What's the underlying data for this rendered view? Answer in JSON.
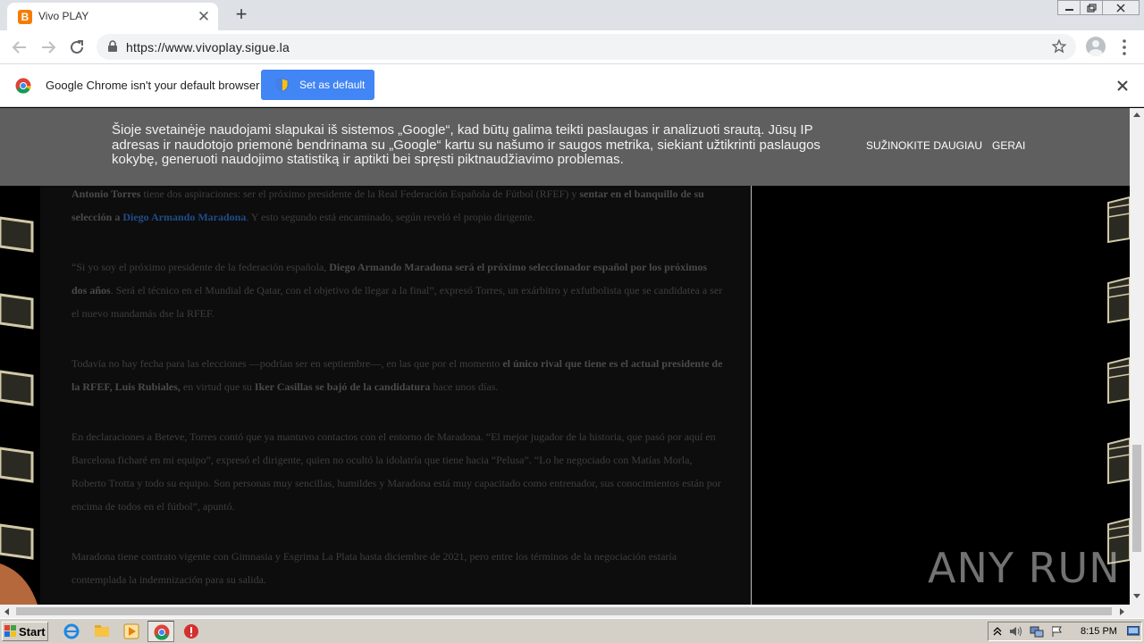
{
  "browser": {
    "tab_title": "Vivo PLAY",
    "url": "https://www.vivoplay.sigue.la"
  },
  "infobar": {
    "message": "Google Chrome isn't your default browser",
    "button_label": "Set as default"
  },
  "cookie_banner": {
    "text": "Šioje svetainėje naudojami slapukai iš sistemos „Google“, kad būtų galima teikti paslaugas ir analizuoti srautą. Jūsų IP adresas ir naudotojo priemonė bendrinama su „Google“ kartu su našumo ir saugos metrika, siekiant užtikrinti paslaugos kokybę, generuoti naudojimo statistiką ir aptikti bei spręsti piktnaudžiavimo problemas.",
    "learn_more": "SUŽINOKITE DAUGIAU",
    "accept": "GERAI"
  },
  "article": {
    "p1": {
      "b1": "Antonio Torres",
      "t1": " tiene dos aspiraciones: ser el próximo presidente de la Real Federación Española de Fútbol (RFEF) y ",
      "b2": "sentar en el banquillo de su selección a ",
      "link": "Diego Armando Maradona",
      "t2": ". Y esto segundo está encaminado, según reveló el propio dirigente."
    },
    "p2": {
      "t1": "“Si yo soy el próximo presidente de la federación española, ",
      "b1": "Diego Armando Maradona será el próximo seleccionador español por los próximos dos años",
      "t2": ". Será el técnico en el Mundial de Qatar, con el objetivo de llegar a la final”, expresó Torres, un exárbitro y exfutbolista que se candidatea a ser el nuevo mandamás dse la RFEF."
    },
    "p3": {
      "t1": "Todavía no hay fecha para las elecciones —podrían ser en septiembre—, en las que por el momento ",
      "b1": "el único rival que tiene es el actual presidente de la RFEF, Luis Rubiales,",
      "t2": " en virtud que su ",
      "b2": "Iker Casillas se bajó de la candidatura",
      "t3": " hace unos días."
    },
    "p4": "En declaraciones a Beteve, Torres contó que ya mantuvo contactos con el entorno de Maradona. “El mejor jugador de la historia, que pasó por aquí en Barcelona ficharé en mi equipo”, expresó el dirigente, quien no ocultó la idolatría que tiene hacia “Pelusa”. “Lo he negociado con Matías Morla, Roberto Trotta y todo su equipo. Son personas muy sencillas, humildes y Maradona está muy capacitado como entrenador, sus conocimientos están por encima de todos en el fútbol”, apuntó.",
    "p5": "Maradona tiene contrato vigente con Gimnasia y Esgrima La Plata hasta diciembre de 2021, pero entre los términos de la negociación estaría contemplada la indemnización para su salida."
  },
  "watermark": "ANY RUN",
  "taskbar": {
    "start_label": "Start",
    "clock": "8:15 PM"
  }
}
